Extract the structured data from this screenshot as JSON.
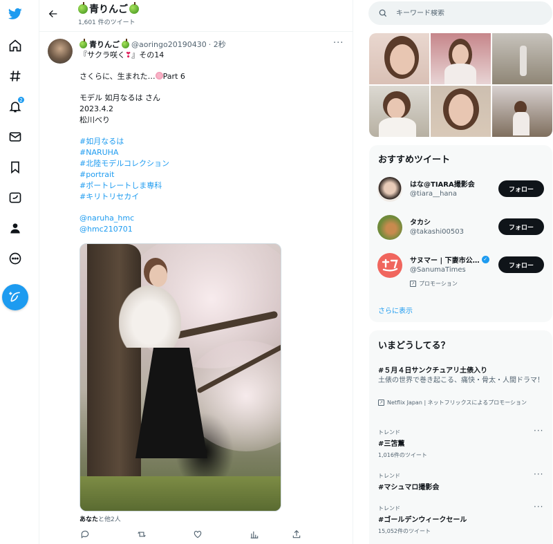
{
  "nav": {
    "notifications_badge": "2"
  },
  "header": {
    "name": "青りんご",
    "tweet_count": "1,601 件のツイート"
  },
  "tweet": {
    "name": "青りんご",
    "handle": "@aoringo20190430",
    "time": "· 2秒",
    "more": "···",
    "line1a": "『サクラ咲く",
    "heart": "❣",
    "line1b": "』その14",
    "line2a": "さくらに、生まれた…",
    "line2b": "Part 6",
    "line3": "モデル 如月なるは さん",
    "line4": "2023.4.2",
    "line5": "松川べり",
    "hashtags": [
      "#如月なるは",
      "#NARUHA",
      "#北陸モデルコレクション",
      "#portrait",
      "#ポートレートしま専科",
      "#キリトリセカイ"
    ],
    "mentions": [
      "@naruha_hmc",
      "@hmc210701"
    ],
    "liked_by_bold": "あなた",
    "liked_by_rest": "と他2人"
  },
  "search": {
    "placeholder": "キーワード検索"
  },
  "recommend": {
    "title": "おすすめツイート",
    "users": [
      {
        "name": "はな@TIARA撮影会",
        "handle": "@tiara__hana",
        "button": "フォロー"
      },
      {
        "name": "タカシ",
        "handle": "@takashi00503",
        "button": "フォロー"
      },
      {
        "name": "サヌマー | 下妻市公…",
        "handle": "@SanumaTimes",
        "button": "フォロー",
        "promo": "プロモーション"
      }
    ],
    "more": "さらに表示"
  },
  "trends": {
    "title": "いまどうしてる？",
    "promoted": {
      "name": "#５月４日サンクチュアリ土俵入り",
      "desc": "土俵の世界で巻き起こる、痛快・骨太・人間ドラマ！",
      "by": "Netflix Japan | ネットフリックスによるプロモーション"
    },
    "items": [
      {
        "category": "トレンド",
        "name": "#三笘薫",
        "count": "1,016件のツイート"
      },
      {
        "category": "トレンド",
        "name": "#マシュマロ撮影会",
        "count": ""
      },
      {
        "category": "トレンド",
        "name": "#ゴールデンウィークセール",
        "count": "15,052件のツイート"
      }
    ]
  },
  "colors": {
    "accent": "#1d9bf0",
    "text": "#0f1419",
    "muted": "#536471"
  }
}
